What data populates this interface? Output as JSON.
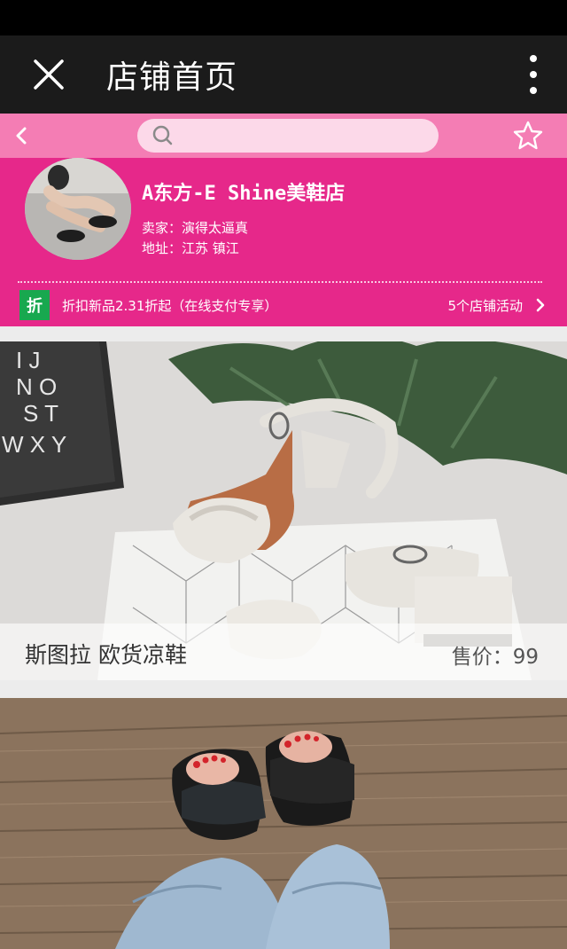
{
  "header": {
    "title": "店铺首页",
    "close_icon": "close-icon",
    "more_icon": "more-vertical-icon"
  },
  "search": {
    "placeholder": "",
    "back_icon": "chevron-left-icon",
    "search_icon": "search-icon",
    "favorite_icon": "star-outline-icon"
  },
  "shop": {
    "name": "A东方-E Shine美鞋店",
    "seller": "卖家：演得太逼真",
    "address": "地址：江苏 镇江",
    "promo_badge": "折",
    "promo_text": "折扣新品2.31折起（在线支付专享）",
    "activity_count": "5个店铺活动"
  },
  "products": [
    {
      "name": "斯图拉 欧货凉鞋",
      "price": "售价：99"
    },
    {
      "name": "",
      "price": ""
    }
  ],
  "colors": {
    "title_bar": "#1b1b1b",
    "search_row": "#f47db4",
    "search_box": "#fcd9e9",
    "shop_header": "#e6288a",
    "discount_badge": "#18a84f"
  }
}
